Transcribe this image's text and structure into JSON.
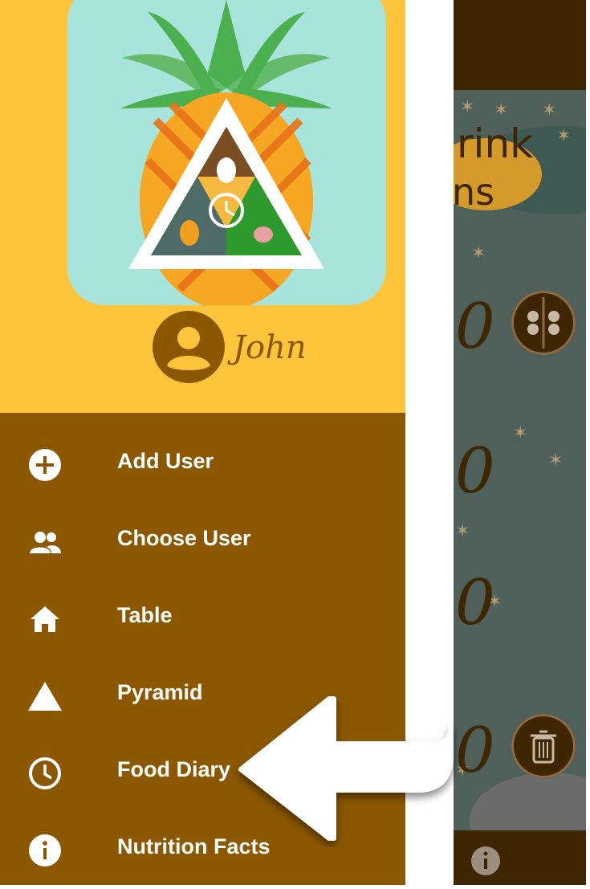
{
  "user": {
    "name": "John"
  },
  "menu": [
    {
      "label": "Add User",
      "icon": "add-circle-icon"
    },
    {
      "label": "Choose User",
      "icon": "people-icon"
    },
    {
      "label": "Table",
      "icon": "home-icon"
    },
    {
      "label": "Pyramid",
      "icon": "triangle-icon"
    },
    {
      "label": "Food Diary",
      "icon": "clock-icon"
    },
    {
      "label": "Nutrition Facts",
      "icon": "info-icon"
    }
  ],
  "background": {
    "title_fragment_1": "rink",
    "title_fragment_2": "ns",
    "counters": [
      "0",
      "0",
      "0",
      "0"
    ]
  },
  "colors": {
    "drawer": "#8b5700",
    "header": "#fdc43c",
    "app_bar": "#3d2600",
    "content": "#4f5f5a"
  }
}
